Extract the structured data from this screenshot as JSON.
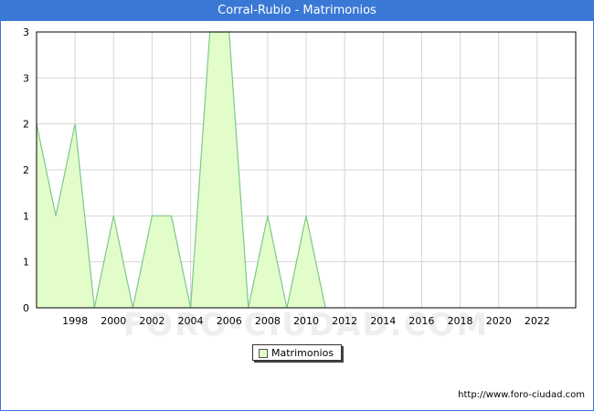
{
  "chart_data": {
    "type": "area",
    "title": "Corral-Rubio - Matrimonios",
    "xlabel": "",
    "ylabel": "",
    "x": [
      1996,
      1997,
      1998,
      1999,
      2000,
      2001,
      2002,
      2003,
      2004,
      2005,
      2006,
      2007,
      2008,
      2009,
      2010,
      2011
    ],
    "series": [
      {
        "name": "Matrimonios",
        "values": [
          2,
          1,
          2,
          0,
          1,
          0,
          1,
          1,
          0,
          3,
          3,
          0,
          1,
          0,
          1,
          0
        ],
        "color": "#e2fdca",
        "line_color": "#7dc88a"
      }
    ],
    "xlim": [
      1996,
      2024
    ],
    "ylim": [
      0,
      3
    ],
    "x_ticks": [
      "1998",
      "2000",
      "2002",
      "2004",
      "2006",
      "2008",
      "2010",
      "2012",
      "2014",
      "2016",
      "2018",
      "2020",
      "2022"
    ],
    "y_ticks": [
      "0",
      "1",
      "1",
      "2",
      "2",
      "3",
      "3"
    ],
    "grid": true,
    "legend_position": "bottom-center",
    "watermark": "FORO-CIUDAD.COM"
  },
  "source_url": "http://www.foro-ciudad.com",
  "colors": {
    "title_bar": "#3a78d6",
    "grid": "#d6d6d6",
    "axis": "#000000"
  }
}
